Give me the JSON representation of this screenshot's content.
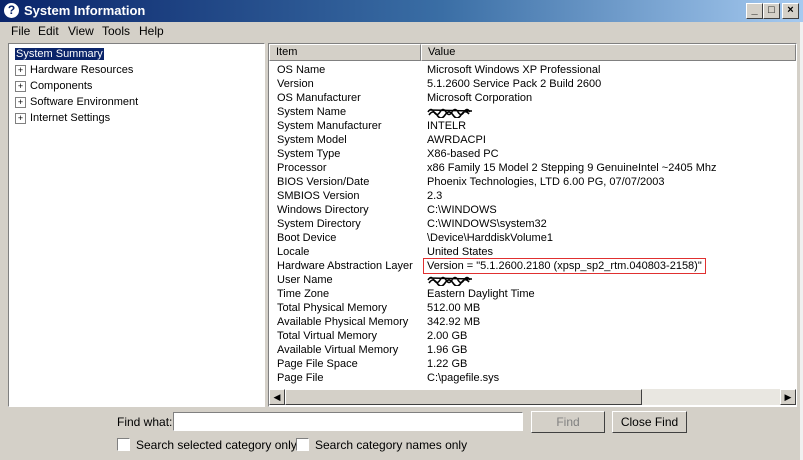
{
  "window": {
    "title": "System Information",
    "app_icon": "?"
  },
  "title_buttons": {
    "minimize": "_",
    "maximize": "□",
    "close": "×"
  },
  "menu": [
    "File",
    "Edit",
    "View",
    "Tools",
    "Help"
  ],
  "tree": [
    {
      "label": "System Summary",
      "expander": "",
      "selected": true
    },
    {
      "label": "Hardware Resources",
      "expander": "+"
    },
    {
      "label": "Components",
      "expander": "+"
    },
    {
      "label": "Software Environment",
      "expander": "+"
    },
    {
      "label": "Internet Settings",
      "expander": "+"
    }
  ],
  "columns": {
    "item": "Item",
    "value": "Value"
  },
  "rows": [
    {
      "item": "OS Name",
      "value": "Microsoft Windows XP Professional"
    },
    {
      "item": "Version",
      "value": "5.1.2600 Service Pack 2 Build 2600"
    },
    {
      "item": "OS Manufacturer",
      "value": "Microsoft Corporation"
    },
    {
      "item": "System Name",
      "value": "",
      "redacted": true
    },
    {
      "item": "System Manufacturer",
      "value": "INTELR"
    },
    {
      "item": "System Model",
      "value": "AWRDACPI"
    },
    {
      "item": "System Type",
      "value": "X86-based PC"
    },
    {
      "item": "Processor",
      "value": "x86 Family 15 Model 2 Stepping 9 GenuineIntel ~2405 Mhz"
    },
    {
      "item": "BIOS Version/Date",
      "value": "Phoenix Technologies, LTD 6.00 PG, 07/07/2003"
    },
    {
      "item": "SMBIOS Version",
      "value": "2.3"
    },
    {
      "item": "Windows Directory",
      "value": "C:\\WINDOWS"
    },
    {
      "item": "System Directory",
      "value": "C:\\WINDOWS\\system32"
    },
    {
      "item": "Boot Device",
      "value": "\\Device\\HarddiskVolume1"
    },
    {
      "item": "Locale",
      "value": "United States"
    },
    {
      "item": "Hardware Abstraction Layer",
      "value": "Version = \"5.1.2600.2180 (xpsp_sp2_rtm.040803-2158)\"",
      "highlight": true
    },
    {
      "item": "User Name",
      "value": "",
      "redacted": true
    },
    {
      "item": "Time Zone",
      "value": "Eastern Daylight Time"
    },
    {
      "item": "Total Physical Memory",
      "value": "512.00 MB"
    },
    {
      "item": "Available Physical Memory",
      "value": "342.92 MB"
    },
    {
      "item": "Total Virtual Memory",
      "value": "2.00 GB"
    },
    {
      "item": "Available Virtual Memory",
      "value": "1.96 GB"
    },
    {
      "item": "Page File Space",
      "value": "1.22 GB"
    },
    {
      "item": "Page File",
      "value": "C:\\pagefile.sys"
    }
  ],
  "scrollbar": {
    "left_arrow": "◀",
    "right_arrow": "▶"
  },
  "find": {
    "label": "Find what:",
    "value": "",
    "find_button": "Find",
    "close_button": "Close Find",
    "check_selected_category": "Search selected category only",
    "check_category_names": "Search category names only"
  },
  "colors": {
    "titlebar_start": "#0a246a",
    "titlebar_end": "#a6caf0",
    "face": "#d4d0c8",
    "highlight_border": "#e03030"
  }
}
